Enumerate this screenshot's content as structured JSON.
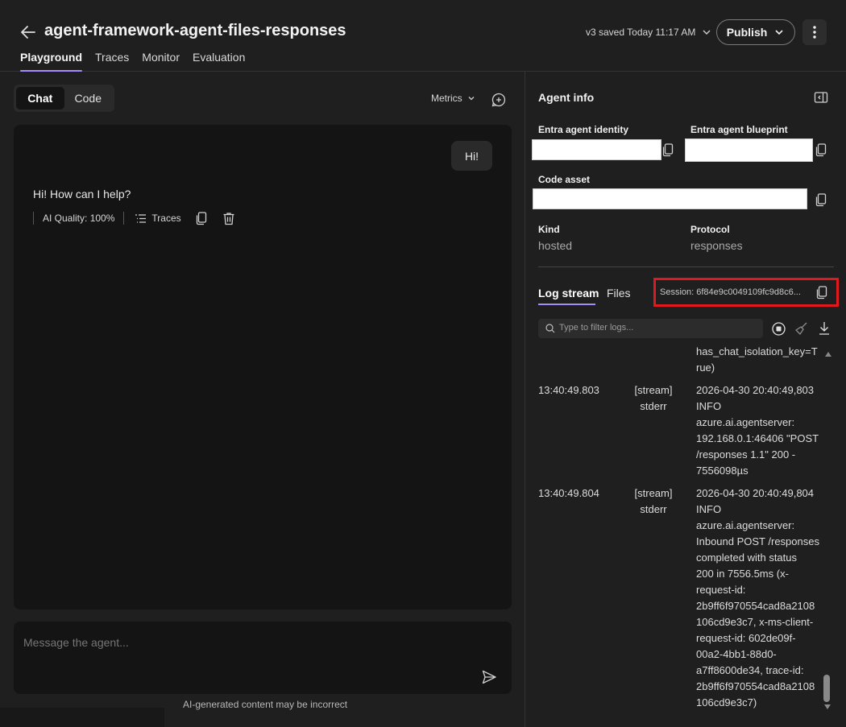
{
  "header": {
    "title": "agent-framework-agent-files-responses",
    "version_status": "v3 saved Today 11:17 AM",
    "publish_label": "Publish",
    "tabs": [
      "Playground",
      "Traces",
      "Monitor",
      "Evaluation"
    ]
  },
  "chat": {
    "mode_tabs": [
      "Chat",
      "Code"
    ],
    "metrics_label": "Metrics",
    "user_message": "Hi!",
    "assistant_message": "Hi! How can I help?",
    "ai_quality": "AI Quality: 100%",
    "traces_label": "Traces",
    "composer_placeholder": "Message the agent...",
    "disclaimer": "AI-generated content may be incorrect"
  },
  "agent_info": {
    "title": "Agent info",
    "entra_identity_label": "Entra agent identity",
    "entra_blueprint_label": "Entra agent blueprint",
    "code_asset_label": "Code asset",
    "kind_label": "Kind",
    "kind_value": "hosted",
    "protocol_label": "Protocol",
    "protocol_value": "responses"
  },
  "logs": {
    "tabs": [
      "Log stream",
      "Files"
    ],
    "session": "Session: 6f84e9c0049109fc9d8c6...",
    "filter_placeholder": "Type to filter logs...",
    "partial_top": [
      "has_chat_isolation_key=T",
      "rue)"
    ],
    "entries": [
      {
        "time": "13:40:49.803",
        "source": [
          "[stream]",
          "stderr"
        ],
        "message": [
          "2026-04-30 20:40:49,803",
          "INFO",
          "azure.ai.agentserver:",
          "192.168.0.1:46406 \"POST",
          "/responses 1.1\" 200 -",
          "7556098µs"
        ]
      },
      {
        "time": "13:40:49.804",
        "source": [
          "[stream]",
          "stderr"
        ],
        "message": [
          "2026-04-30 20:40:49,804",
          "INFO",
          "azure.ai.agentserver:",
          "Inbound POST /responses",
          "completed with status",
          "200 in 7556.5ms (x-",
          "request-id:",
          "2b9ff6f970554cad8a2108",
          "106cd9e3c7, x-ms-client-",
          "request-id: 602de09f-",
          "00a2-4bb1-88d0-",
          "a7ff8600de34, trace-id:",
          "2b9ff6f970554cad8a2108",
          "106cd9e3c7)"
        ]
      }
    ]
  },
  "colors": {
    "background": "#1f1f1f",
    "panel": "#141414",
    "accent": "#a78bfa",
    "highlight_box": "#e0191e"
  }
}
